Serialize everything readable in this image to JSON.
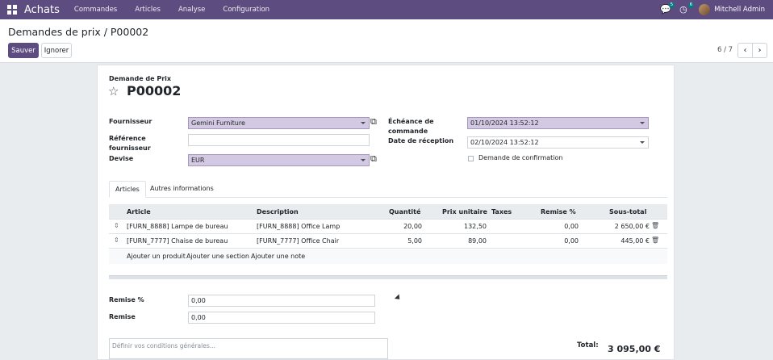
{
  "topbar": {
    "app_name": "Achats",
    "nav": [
      "Commandes",
      "Articles",
      "Analyse",
      "Configuration"
    ],
    "messages_count": "5",
    "activities_count": "6",
    "user": "Mitchell Admin"
  },
  "control": {
    "breadcrumb": "Demandes de prix / P00002",
    "save_label": "Sauver",
    "discard_label": "Ignorer",
    "pager": "6 / 7"
  },
  "form": {
    "doc_type": "Demande de Prix",
    "doc_name": "P00002",
    "labels": {
      "supplier": "Fournisseur",
      "supplier_ref": "Référence fournisseur",
      "currency": "Devise",
      "deadline": "Échéance de commande",
      "receipt_date": "Date de réception",
      "confirm": "Demande de confirmation"
    },
    "values": {
      "supplier": "Gemini Furniture",
      "supplier_ref": "",
      "currency": "EUR",
      "deadline": "01/10/2024 13:52:12",
      "receipt_date": "02/10/2024 13:52:12"
    },
    "tabs": [
      "Articles",
      "Autres informations"
    ],
    "table": {
      "headers": [
        "Article",
        "Description",
        "Quantité",
        "Prix unitaire",
        "Taxes",
        "Remise %",
        "Sous-total"
      ],
      "rows": [
        {
          "article": "[FURN_8888] Lampe de bureau",
          "description": "[FURN_8888] Office Lamp",
          "qty": "20,00",
          "price": "132,50",
          "taxes": "",
          "discount": "0,00",
          "subtotal": "2 650,00 €"
        },
        {
          "article": "[FURN_7777] Chaise de bureau",
          "description": "[FURN_7777] Office Chair",
          "qty": "5,00",
          "price": "89,00",
          "taxes": "",
          "discount": "0,00",
          "subtotal": "445,00 €"
        }
      ],
      "add_links": [
        "Ajouter un produit",
        "Ajouter une section",
        "Ajouter une note"
      ]
    },
    "discount_label": "Remise %",
    "discount_value": "0,00",
    "remise_label": "Remise",
    "remise_value": "0,00",
    "notes_placeholder": "Définir vos conditions générales...",
    "total_label": "Total:",
    "total_value": "3 095,00 €"
  },
  "colors": {
    "brand": "#5c4c7f",
    "highlight": "#d3c9e3"
  }
}
